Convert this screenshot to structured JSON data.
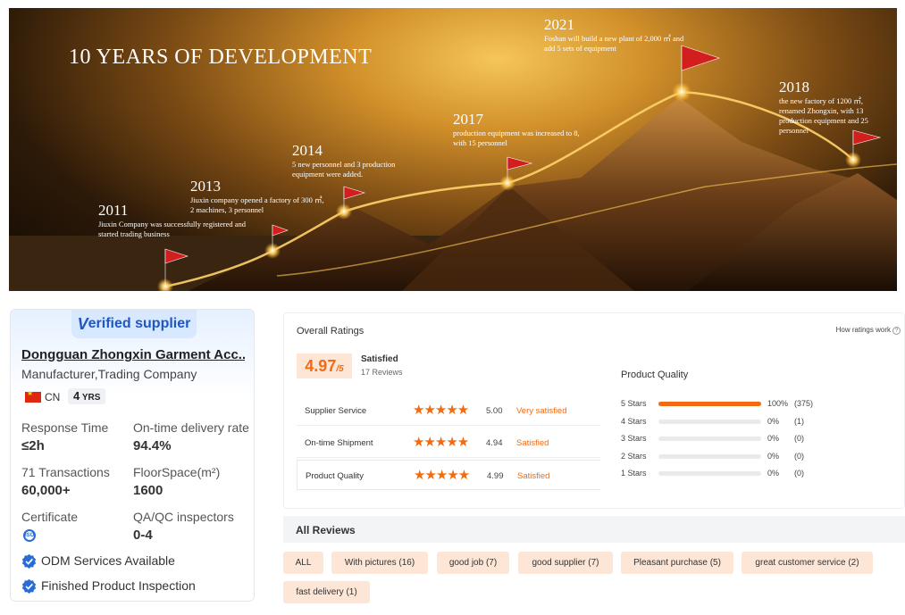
{
  "banner": {
    "title": "10 YEARS OF DEVELOPMENT",
    "milestones": [
      {
        "year": "2011",
        "desc": "Jiuxin Company was successfully registered and started trading business"
      },
      {
        "year": "2013",
        "desc": "Jiuxin company opened a factory of 300 ㎡, 2 machines, 3 personnel"
      },
      {
        "year": "2014",
        "desc": "5 new personnel and 3 production equipment were added."
      },
      {
        "year": "2017",
        "desc": "production equipment was increased to 8, with 15 personnel"
      },
      {
        "year": "2021",
        "desc": "Foshan will build a new plant of 2,000 ㎡ and add 5 sets of equipment"
      },
      {
        "year": "2018",
        "desc": "the new factory of 1200 ㎡, renamed Zhongxin, with 13 production equipment and 25 personnel"
      }
    ]
  },
  "supplier": {
    "badge_v": "V",
    "badge_rest": "erified supplier",
    "company": "Dongguan Zhongxin Garment Acc...",
    "type": "Manufacturer,Trading Company",
    "country": "CN",
    "years_num": "4",
    "years_unit": "YRS",
    "stats": [
      {
        "label": "Response Time",
        "value": "≤2h"
      },
      {
        "label": "On-time delivery rate",
        "value": "94.4%"
      },
      {
        "label": "71 Transactions",
        "value": "60,000+"
      },
      {
        "label": "FloorSpace(m²)",
        "value": "1600"
      },
      {
        "label": "Certificate",
        "value": ""
      },
      {
        "label": "QA/QC inspectors",
        "value": "0-4"
      }
    ],
    "cert_icon": "ISO",
    "services": [
      "ODM Services Available",
      "Finished Product Inspection"
    ],
    "colors": {
      "badge": "#1f56c4",
      "check": "#2a6cd6"
    }
  },
  "ratings": {
    "title": "Overall Ratings",
    "how_link": "How ratings work",
    "score": "4.97",
    "score_max": "/5",
    "sentiment": "Satisfied",
    "review_count": "17 Reviews",
    "subratings": [
      {
        "label": "Supplier Service",
        "stars": "★★★★★",
        "value": "5.00",
        "word": "Very satisfied"
      },
      {
        "label": "On-time Shipment",
        "stars": "★★★★★",
        "value": "4.94",
        "word": "Satisfied"
      },
      {
        "label": "Product Quality",
        "stars": "★★★★★",
        "value": "4.99",
        "word": "Satisfied"
      }
    ],
    "breakdown_title": "Product Quality",
    "breakdown": [
      {
        "label": "5 Stars",
        "fraction": 1.0,
        "pct": "100%",
        "count": "(375)"
      },
      {
        "label": "4 Stars",
        "fraction": 0,
        "pct": "0%",
        "count": "(1)"
      },
      {
        "label": "3 Stars",
        "fraction": 0,
        "pct": "0%",
        "count": "(0)"
      },
      {
        "label": "2 Stars",
        "fraction": 0,
        "pct": "0%",
        "count": "(0)"
      },
      {
        "label": "1 Stars",
        "fraction": 0,
        "pct": "0%",
        "count": "(0)"
      }
    ],
    "accent": "#f26b12"
  },
  "reviews": {
    "title": "All Reviews",
    "tags": [
      "ALL",
      "With pictures (16)",
      "good job (7)",
      "good supplier (7)",
      "Pleasant purchase (5)",
      "great customer service (2)",
      "fast delivery (1)"
    ]
  }
}
